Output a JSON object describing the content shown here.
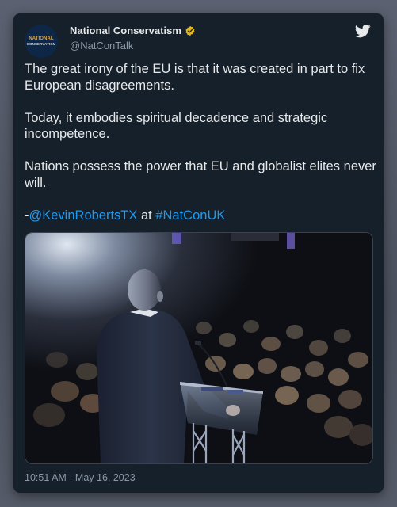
{
  "author": {
    "display_name": "National Conservatism",
    "handle": "@NatConTalk",
    "avatar_text_top": "NATIONAL",
    "avatar_text_bottom": "CONSERVATISM",
    "verified": true
  },
  "tweet": {
    "paragraph1": "The great irony of the EU is that it was created in part to fix European disagreements.",
    "paragraph2": "Today, it embodies spiritual decadence and strategic incompetence.",
    "paragraph3": "Nations possess the power that EU and globalist elites never will.",
    "attribution_prefix": "-",
    "mention": "@KevinRobertsTX",
    "attribution_middle": " at ",
    "hashtag": "#NatConUK",
    "timestamp": "10:51 AM · May 16, 2023"
  },
  "icons": {
    "platform": "twitter-bird-icon",
    "verified": "verified-badge-icon"
  },
  "colors": {
    "card_background": "#15202b",
    "text_primary": "#e7e9ea",
    "text_secondary": "#8b98a5",
    "link": "#1d9bf0",
    "verified_badge": "#e2b719"
  }
}
